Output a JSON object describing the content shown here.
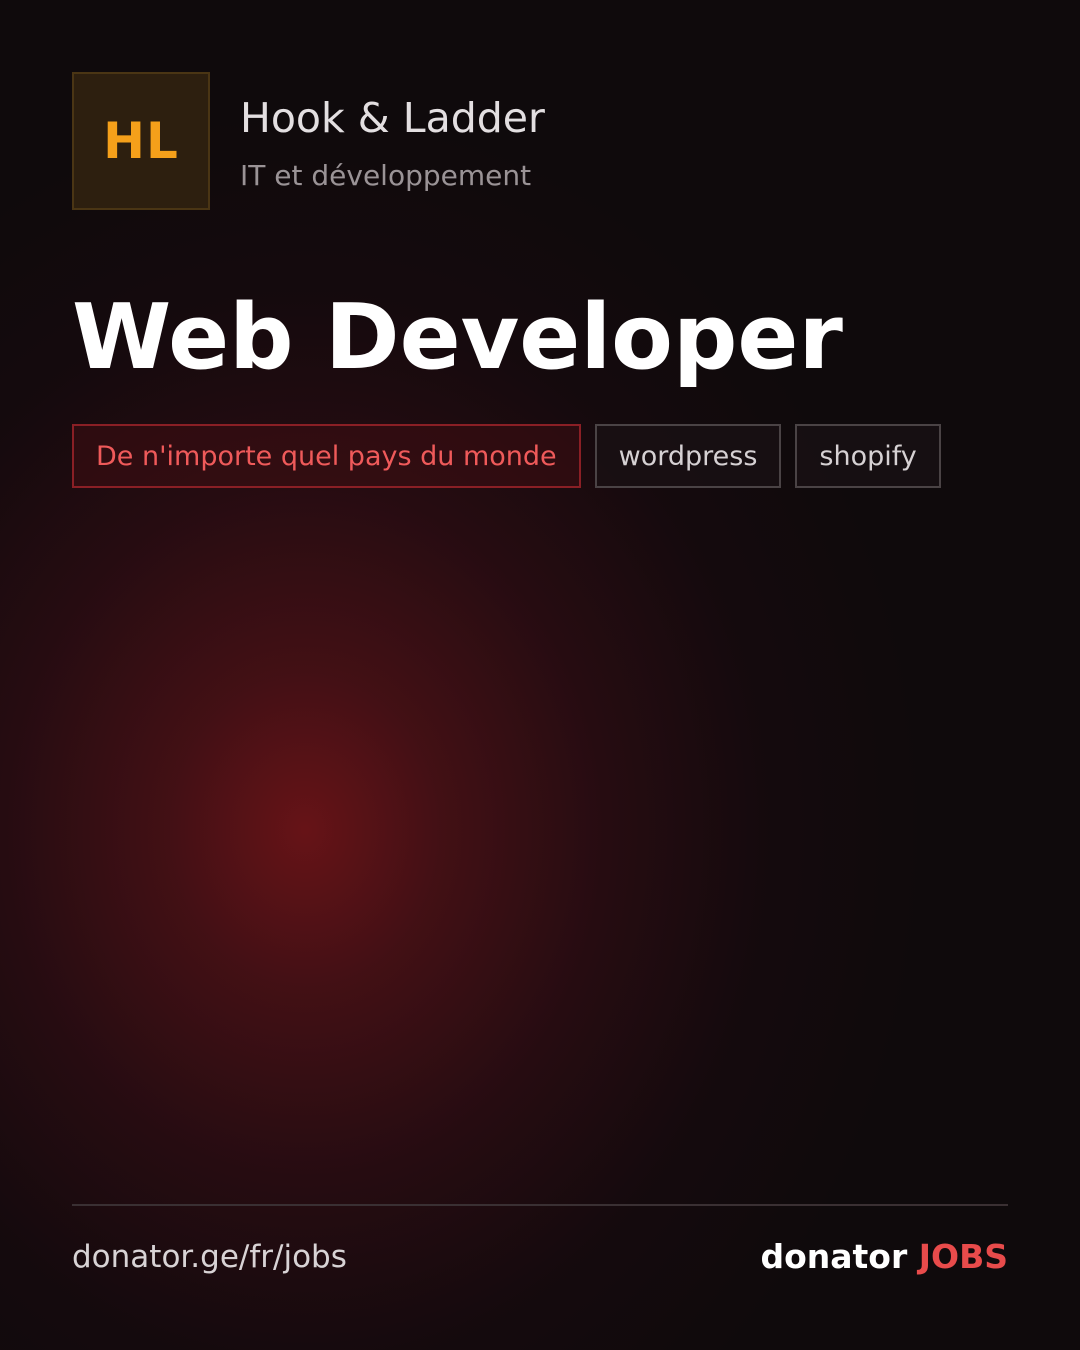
{
  "company": {
    "initials": "HL",
    "name": "Hook & Ladder",
    "sector": "IT et développement"
  },
  "job": {
    "title": "Web Developer"
  },
  "tags": [
    {
      "label": "De n'importe quel pays du monde",
      "kind": "location"
    },
    {
      "label": "wordpress",
      "kind": "skill"
    },
    {
      "label": "shopify",
      "kind": "skill"
    }
  ],
  "footer": {
    "url": "donator.ge/fr/jobs",
    "brand_main": "donator",
    "brand_accent": "JOBS"
  },
  "colors": {
    "accent_red": "#e84b4b",
    "logo_orange": "#f5a01a"
  }
}
